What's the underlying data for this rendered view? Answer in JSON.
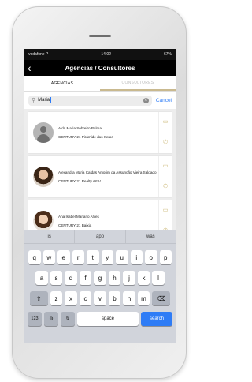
{
  "status": {
    "carrier": "vodafone P",
    "time": "14:02",
    "battery": "67%"
  },
  "nav": {
    "back": "‹",
    "title": "Agências / Consultores"
  },
  "tabs": [
    {
      "label": "AGÊNCIAS"
    },
    {
      "label": "CONSULTORES"
    }
  ],
  "search": {
    "value": "Maria",
    "cancel": "Cancel"
  },
  "results": [
    {
      "name": "Alda Maria Sobreiro Palma",
      "agency": "CENTURY 21 Pirâmide das Keras"
    },
    {
      "name": "Alexandra Maria Caldas Amorim da Assunção Vieira Salgado",
      "agency": "CENTURY 21 Realty Art V"
    },
    {
      "name": "Ana Isabel Mariano Alves",
      "agency": "CENTURY 21 Baixia"
    }
  ],
  "keyboard": {
    "suggestions": [
      "is",
      "app",
      "was"
    ],
    "row1": [
      "q",
      "w",
      "e",
      "r",
      "t",
      "y",
      "u",
      "i",
      "o",
      "p"
    ],
    "row2": [
      "a",
      "s",
      "d",
      "f",
      "g",
      "h",
      "j",
      "k",
      "l"
    ],
    "row3": [
      "z",
      "x",
      "c",
      "v",
      "b",
      "n",
      "m"
    ],
    "numbers": "123",
    "space": "space",
    "action": "search"
  }
}
